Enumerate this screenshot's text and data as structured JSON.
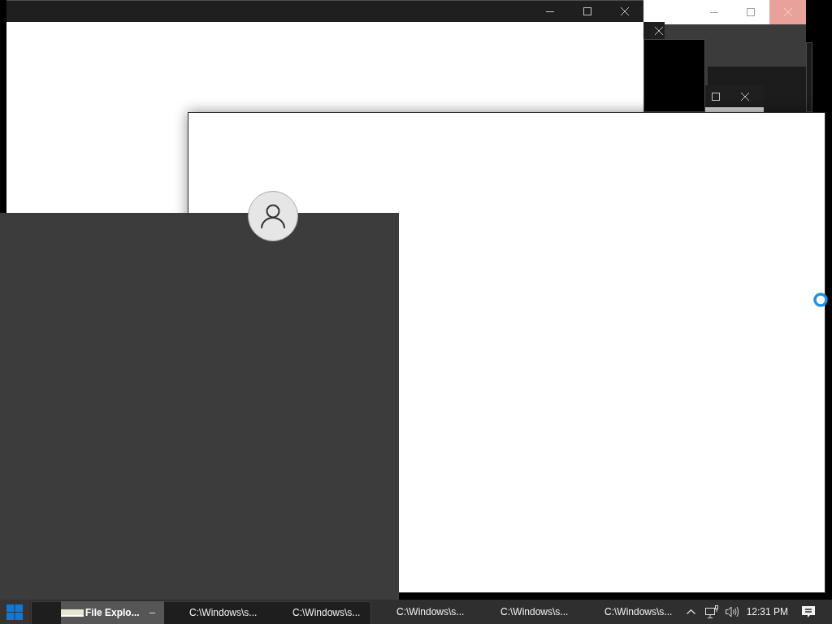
{
  "windows": [
    {
      "kind": "light-titlebar",
      "buttons": [
        {
          "kind": "minimize",
          "highlighted": false
        },
        {
          "kind": "maximize",
          "highlighted": false
        },
        {
          "kind": "close",
          "highlighted": true
        }
      ]
    },
    {
      "kind": "dark-titlebar",
      "buttons": [
        {
          "kind": "close",
          "highlighted": false
        }
      ]
    },
    {
      "kind": "plain"
    },
    {
      "kind": "plain"
    },
    {
      "kind": "plain"
    },
    {
      "kind": "dark-titlebar",
      "buttons": [
        {
          "kind": "maximize",
          "highlighted": false
        },
        {
          "kind": "close",
          "highlighted": false
        }
      ]
    },
    {
      "kind": "dark-titlebar",
      "buttons": [
        {
          "kind": "minimize",
          "highlighted": false
        },
        {
          "kind": "maximize",
          "highlighted": false
        },
        {
          "kind": "close",
          "highlighted": false
        }
      ]
    },
    {
      "kind": "plain"
    }
  ],
  "taskbar": {
    "group": [
      {
        "label": "File Explo...",
        "selected": true
      },
      {
        "label": "C:\\Windows\\s...",
        "selected": false
      },
      {
        "label": "C:\\Windows\\s...",
        "selected": false
      }
    ],
    "buttons": [
      {
        "label": "C:\\Windows\\s...",
        "selected": false
      },
      {
        "label": "C:\\Windows\\s...",
        "selected": false
      },
      {
        "label": "C:\\Windows\\s...",
        "selected": false
      }
    ],
    "clock": "12:31 PM"
  }
}
